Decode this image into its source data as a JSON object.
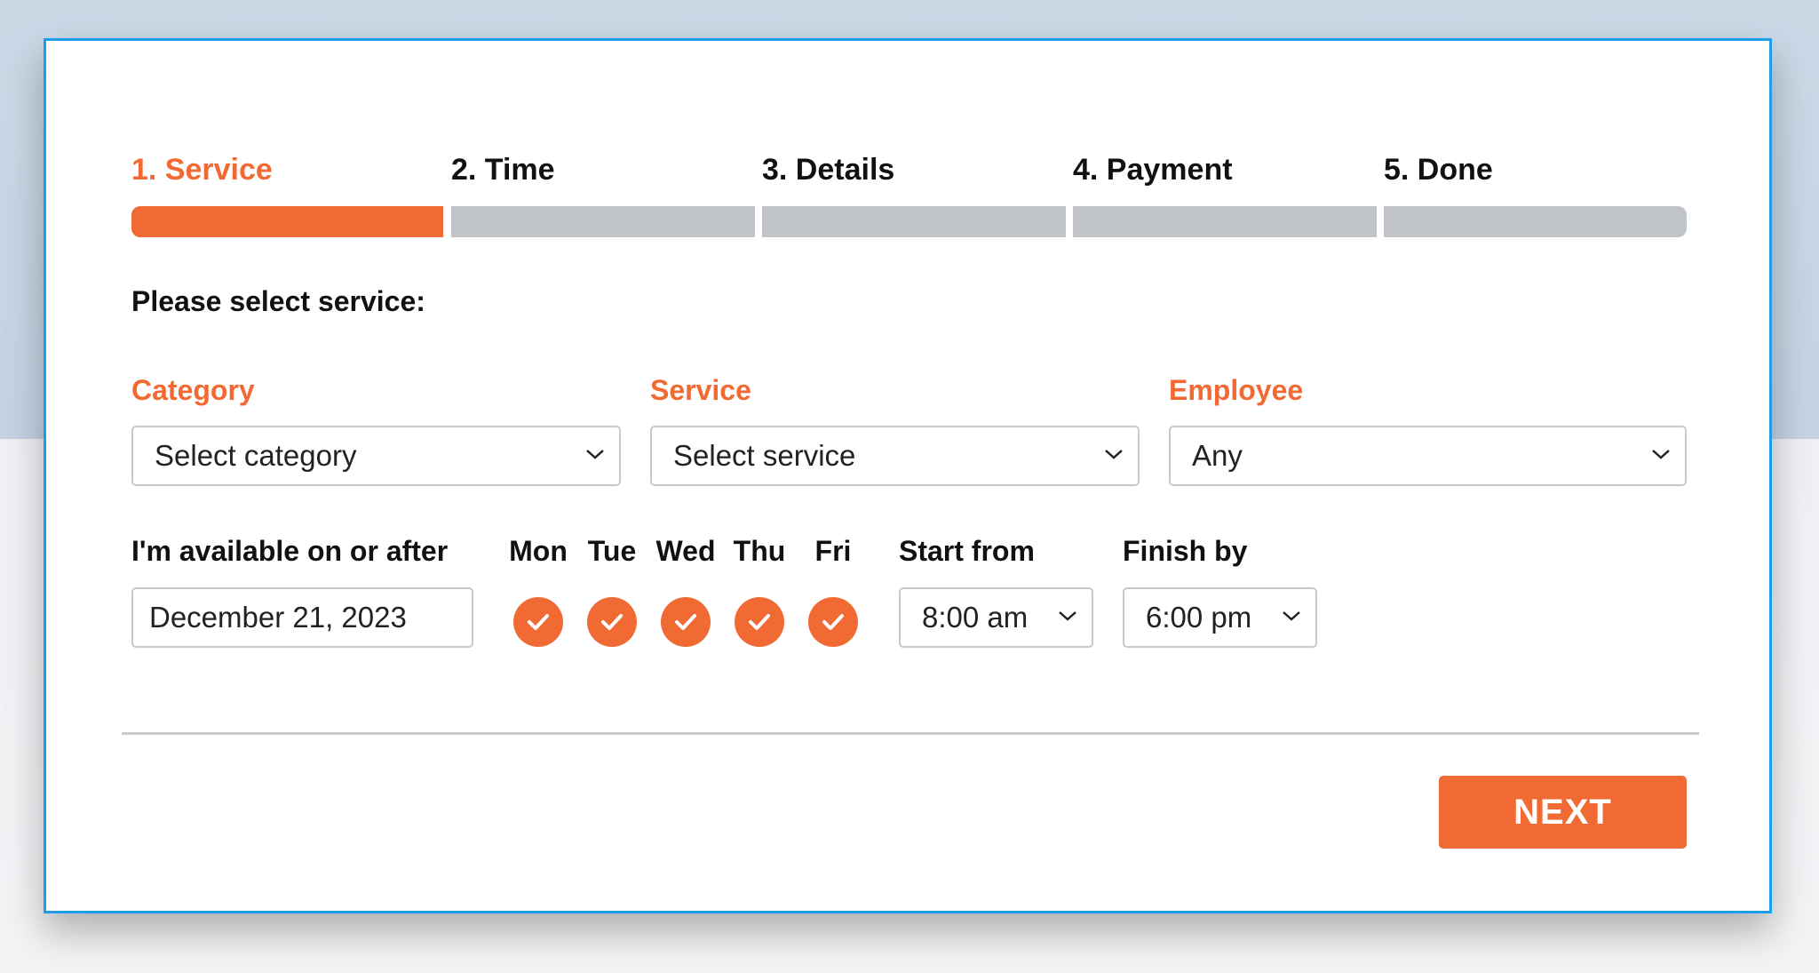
{
  "steps": [
    {
      "label": "1. Service",
      "active": true
    },
    {
      "label": "2. Time",
      "active": false
    },
    {
      "label": "3. Details",
      "active": false
    },
    {
      "label": "4. Payment",
      "active": false
    },
    {
      "label": "5. Done",
      "active": false
    }
  ],
  "heading": "Please select service:",
  "fields": {
    "category": {
      "label": "Category",
      "value": "Select category"
    },
    "service": {
      "label": "Service",
      "value": "Select service"
    },
    "employee": {
      "label": "Employee",
      "value": "Any"
    }
  },
  "availability": {
    "label": "I'm available on or after",
    "date": "December 21, 2023",
    "days": [
      {
        "label": "Mon",
        "checked": true
      },
      {
        "label": "Tue",
        "checked": true
      },
      {
        "label": "Wed",
        "checked": true
      },
      {
        "label": "Thu",
        "checked": true
      },
      {
        "label": "Fri",
        "checked": true
      }
    ],
    "start_label": "Start from",
    "start_value": "8:00 am",
    "finish_label": "Finish by",
    "finish_value": "6:00 pm"
  },
  "next_label": "NEXT",
  "colors": {
    "accent": "#f26a33",
    "frame": "#1e9de8",
    "inactive_bar": "#c0c3c8"
  },
  "icons": {
    "dropdown": "chevron-down-icon",
    "day_check": "check-icon"
  }
}
